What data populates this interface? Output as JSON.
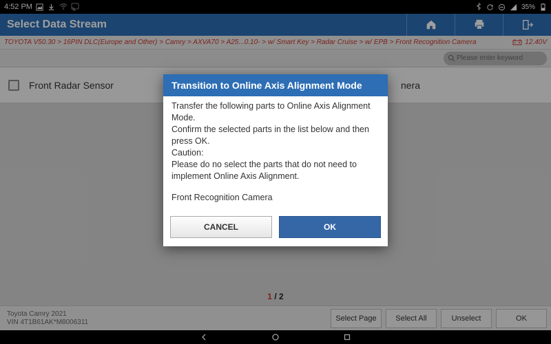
{
  "status": {
    "time": "4:52 PM",
    "battery_pct": "35%"
  },
  "header": {
    "title": "Select Data Stream"
  },
  "breadcrumb": {
    "path": "TOYOTA V50.30 > 16PIN DLC(Europe and Other) > Camry > AXVA70 > A25...0.10- > w/ Smart Key > Radar Cruise > w/ EPB > Front Recognition Camera",
    "voltage": "12.40V"
  },
  "search": {
    "placeholder": "Please enter keyword"
  },
  "list": {
    "items": [
      {
        "label": "Front Radar Sensor"
      },
      {
        "label": "Front Recognition Camera",
        "truncated": "nera"
      }
    ]
  },
  "pager": {
    "current": "1",
    "sep": " / ",
    "total": "2"
  },
  "vehicle": {
    "line1": "Toyota Camry 2021",
    "line2": "VIN 4T1B61AK*M8006311"
  },
  "bottom_buttons": {
    "select_page": "Select Page",
    "select_all": "Select All",
    "unselect": "Unselect",
    "ok": "OK"
  },
  "dialog": {
    "title": "Transition to Online Axis Alignment Mode",
    "line1": "Transfer the following parts to Online Axis Alignment Mode.",
    "line2": "Confirm the selected parts in the list below and then press OK.",
    "line3": "Caution:",
    "line4": "Please do no select the parts that do not need to implement Online Axis Alignment.",
    "blank": " ",
    "part": "Front Recognition Camera",
    "cancel": "CANCEL",
    "ok": "OK"
  }
}
